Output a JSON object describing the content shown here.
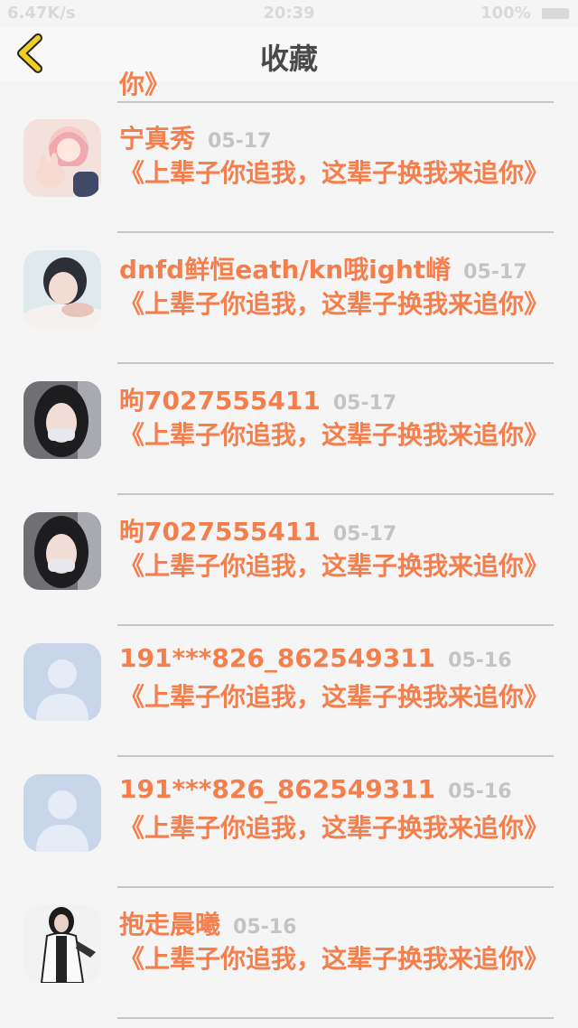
{
  "status": {
    "left": "6.47K/s",
    "time": "20:39",
    "battery": "100%"
  },
  "nav": {
    "title": "收藏"
  },
  "partial_text": "你》",
  "items": [
    {
      "username": "宁真秀",
      "date": "05-17",
      "content": "《上辈子你追我，这辈子换我来追你》",
      "avatar": "anime-girl-avatar"
    },
    {
      "username": "dnfd鲜恒eath/kn哦ight嵴",
      "date": "05-17",
      "content": "《上辈子你追我，这辈子换我来追你》",
      "avatar": "girl-photo-avatar"
    },
    {
      "username": "昫7027555411",
      "date": "05-17",
      "content": "《上辈子你追我，这辈子换我来追你》",
      "avatar": "girl-mask-avatar"
    },
    {
      "username": "昫7027555411",
      "date": "05-17",
      "content": "《上辈子你追我，这辈子换我来追你》",
      "avatar": "girl-mask-avatar"
    },
    {
      "username": "191***826_862549311",
      "date": "05-16",
      "content": "《上辈子你追我，这辈子换我来追你》",
      "avatar": "default-user-avatar"
    },
    {
      "username": "191***826_862549311",
      "date": "05-16",
      "content": "《上辈子你追我，这辈子换我来追你》",
      "avatar": "default-user-avatar"
    },
    {
      "username": "抱走晨曦",
      "date": "05-16",
      "content": "《上辈子你追我，这辈子换我来追你》",
      "avatar": "girl-jacket-avatar"
    }
  ],
  "colors": {
    "accent": "#f47f4d",
    "back_icon": "#f2cf1f"
  }
}
